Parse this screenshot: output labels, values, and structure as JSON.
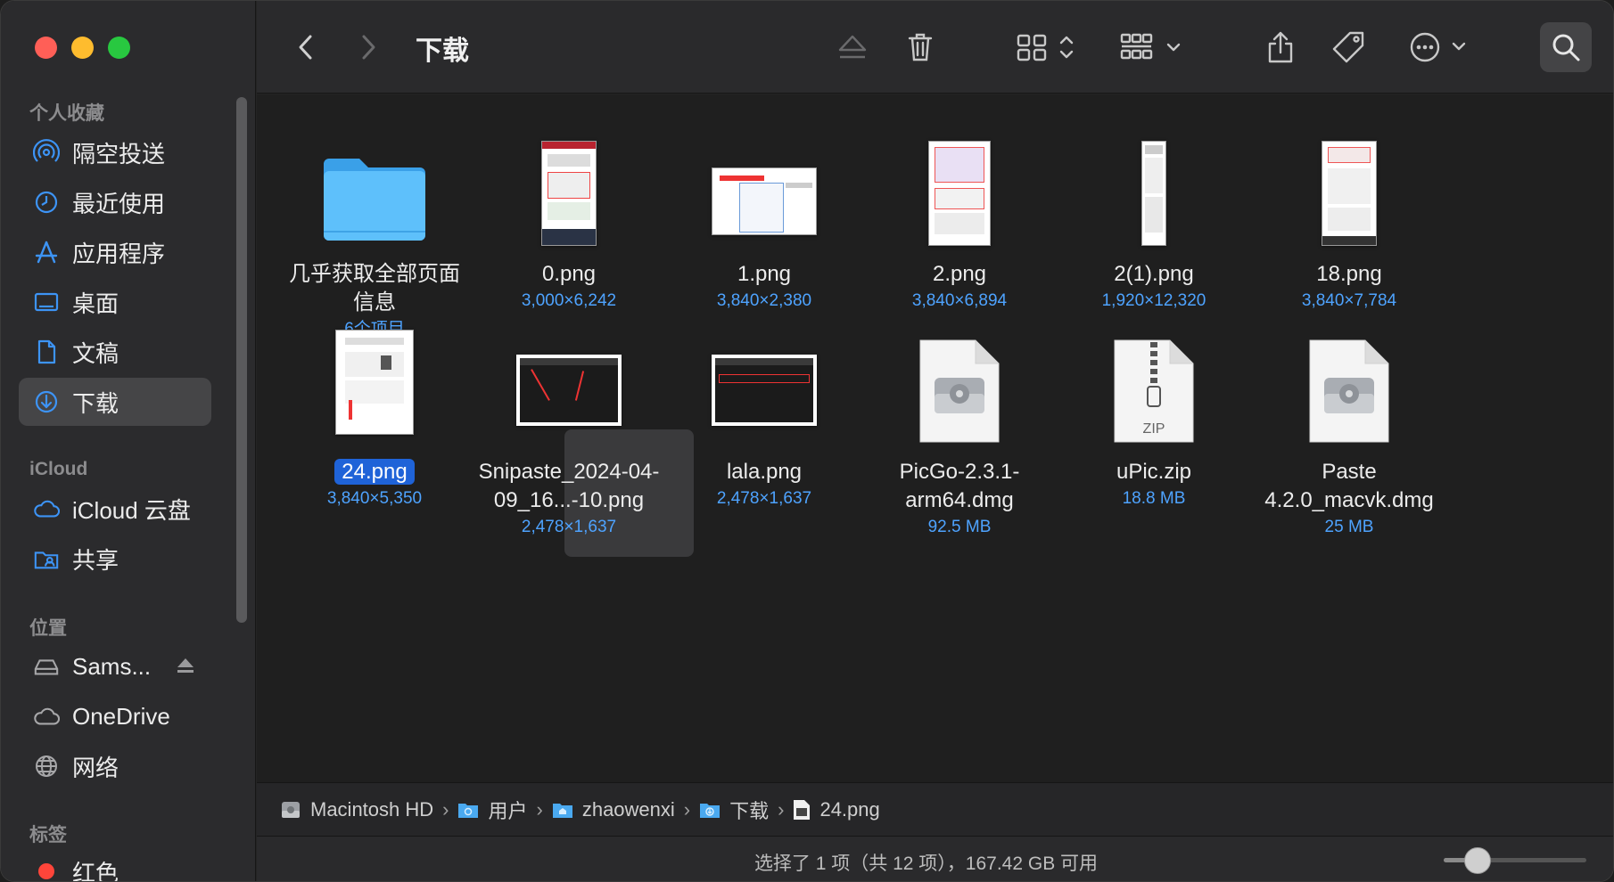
{
  "sidebar": {
    "favorites_label": "个人收藏",
    "favorites": [
      {
        "label": "隔空投送",
        "icon": "airdrop-icon"
      },
      {
        "label": "最近使用",
        "icon": "clock-icon"
      },
      {
        "label": "应用程序",
        "icon": "applications-icon"
      },
      {
        "label": "桌面",
        "icon": "desktop-icon"
      },
      {
        "label": "文稿",
        "icon": "document-icon"
      },
      {
        "label": "下载",
        "icon": "download-icon",
        "active": true
      }
    ],
    "icloud_label": "iCloud",
    "icloud": [
      {
        "label": "iCloud 云盘",
        "icon": "cloud-icon"
      },
      {
        "label": "共享",
        "icon": "shared-folder-icon"
      }
    ],
    "locations_label": "位置",
    "locations": [
      {
        "label": "Sams...",
        "icon": "drive-icon"
      },
      {
        "label": "OneDrive",
        "icon": "cloud-icon"
      },
      {
        "label": "网络",
        "icon": "globe-icon"
      }
    ],
    "tags_label": "标签",
    "tags": [
      {
        "label": "红色",
        "color": "#ff453a"
      }
    ]
  },
  "toolbar": {
    "title": "下载"
  },
  "files": [
    {
      "name": "几乎获取全部页面信息",
      "meta": "6个项目",
      "kind": "folder"
    },
    {
      "name": "0.png",
      "meta": "3,000×6,242",
      "kind": "image"
    },
    {
      "name": "1.png",
      "meta": "3,840×2,380",
      "kind": "image"
    },
    {
      "name": "2.png",
      "meta": "3,840×6,894",
      "kind": "image"
    },
    {
      "name": "2(1).png",
      "meta": "1,920×12,320",
      "kind": "image"
    },
    {
      "name": "18.png",
      "meta": "3,840×7,784",
      "kind": "image"
    },
    {
      "name": "24.png",
      "meta": "3,840×5,350",
      "kind": "image",
      "selected": true
    },
    {
      "name": "Snipaste_2024-04-09_16...-10.png",
      "meta": "2,478×1,637",
      "kind": "image"
    },
    {
      "name": "lala.png",
      "meta": "2,478×1,637",
      "kind": "image"
    },
    {
      "name": "PicGo-2.3.1-arm64.dmg",
      "meta": "92.5 MB",
      "kind": "dmg"
    },
    {
      "name": "uPic.zip",
      "meta": "18.8 MB",
      "kind": "zip"
    },
    {
      "name": "Paste 4.2.0_macvk.dmg",
      "meta": "25 MB",
      "kind": "dmg"
    }
  ],
  "zip_label": "ZIP",
  "pathbar": [
    {
      "label": "Macintosh HD",
      "icon": "hard-drive-icon"
    },
    {
      "label": "用户",
      "icon": "folder-icon"
    },
    {
      "label": "zhaowenxi",
      "icon": "home-folder-icon"
    },
    {
      "label": "下载",
      "icon": "downloads-folder-icon"
    },
    {
      "label": "24.png",
      "icon": "png-file-icon"
    }
  ],
  "status": {
    "text": "选择了 1 项（共 12 项），167.42 GB 可用",
    "icon_size_fraction": 0.24
  }
}
